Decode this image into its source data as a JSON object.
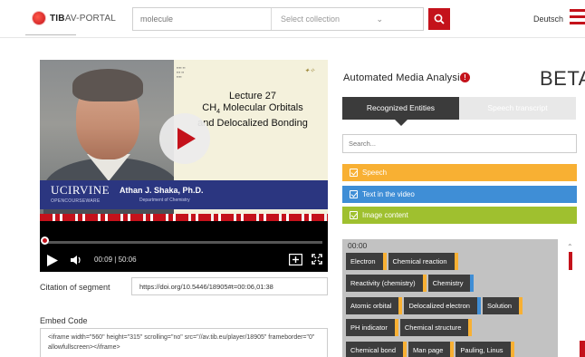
{
  "header": {
    "logo_bold": "TIB",
    "logo_rest": "AV-PORTAL",
    "search_value": "molecule",
    "collection_placeholder": "Select collection",
    "language": "Deutsch"
  },
  "video": {
    "lecture_line1": "Lecture 27",
    "lecture_line2": "CH",
    "lecture_line2_sub": "4",
    "lecture_line2_rest": " Molecular Orbitals",
    "lecture_line3": "and Delocalized Bonding",
    "institution": "UCIRVINE",
    "institution_sub": "OPENCOURSEWARE",
    "presenter": "Athan J. Shaka, Ph.D.",
    "department": "Department of Chemistry",
    "current_time": "00:09",
    "duration": "50:06",
    "progress": 0.003
  },
  "citation": {
    "label": "Citation of segment",
    "value": "https://doi.org/10.5446/18905#t=00:06,01:38"
  },
  "embed": {
    "label": "Embed Code",
    "code": "<iframe width=\"560\" height=\"315\" scrolling=\"no\" src=\"//av.tib.eu/player/18905\" frameborder=\"0\" allowfullscreen></iframe>"
  },
  "analysis": {
    "title": "Automated Media Analysis",
    "badge": "BETA",
    "tabs": [
      "Recognized Entities",
      "Speech transcript"
    ],
    "search_placeholder": "Search...",
    "filters": [
      {
        "label": "Speech",
        "color": "#f8b033"
      },
      {
        "label": "Text in the video",
        "color": "#3f8ed6"
      },
      {
        "label": "Image content",
        "color": "#9fc02f"
      }
    ],
    "timestamp": "00:00",
    "entities": [
      {
        "label": "Electron",
        "source": "speech"
      },
      {
        "label": "Chemical reaction",
        "source": "speech"
      },
      {
        "label": "Reactivity (chemistry)",
        "source": "speech"
      },
      {
        "label": "Chemistry",
        "source": "text"
      },
      {
        "label": "Atomic orbital",
        "source": "speech"
      },
      {
        "label": "Delocalized electron",
        "source": "text"
      },
      {
        "label": "Solution",
        "source": "speech"
      },
      {
        "label": "PH indicator",
        "source": "speech"
      },
      {
        "label": "Chemical structure",
        "source": "speech"
      },
      {
        "label": "Chemical bond",
        "source": "speech"
      },
      {
        "label": "Man page",
        "source": "speech"
      },
      {
        "label": "Pauling, Linus",
        "source": "speech"
      }
    ]
  },
  "colors": {
    "brand_red": "#c4121b",
    "speech": "#f8b033",
    "text": "#3f8ed6",
    "image": "#9fc02f"
  }
}
